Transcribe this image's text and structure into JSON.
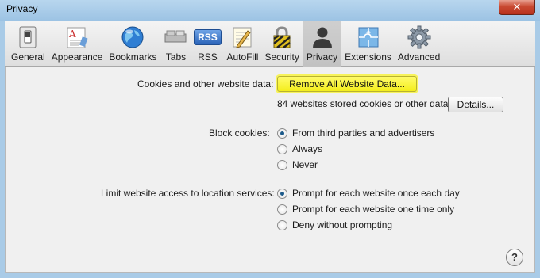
{
  "window": {
    "title": "Privacy",
    "close_label": "✕"
  },
  "toolbar": {
    "items": [
      {
        "label": "General",
        "icon": "switch-icon"
      },
      {
        "label": "Appearance",
        "icon": "font-icon"
      },
      {
        "label": "Bookmarks",
        "icon": "globe-icon"
      },
      {
        "label": "Tabs",
        "icon": "tabs-icon"
      },
      {
        "label": "RSS",
        "icon": "rss-icon"
      },
      {
        "label": "AutoFill",
        "icon": "pencil-icon"
      },
      {
        "label": "Security",
        "icon": "lock-icon"
      },
      {
        "label": "Privacy",
        "icon": "person-silhouette-icon"
      },
      {
        "label": "Extensions",
        "icon": "puzzle-icon"
      },
      {
        "label": "Advanced",
        "icon": "gear-icon"
      }
    ],
    "rss_badge": "RSS",
    "selected": "Privacy"
  },
  "cookies": {
    "label": "Cookies and other website data:",
    "remove_button": "Remove All Website Data...",
    "stored_info": "84 websites stored cookies or other data",
    "details_button": "Details..."
  },
  "block_cookies": {
    "label": "Block cookies:",
    "options": [
      {
        "label": "From third parties and advertisers",
        "checked": true
      },
      {
        "label": "Always",
        "checked": false
      },
      {
        "label": "Never",
        "checked": false
      }
    ]
  },
  "location": {
    "label": "Limit website access to location services:",
    "options": [
      {
        "label": "Prompt for each website once each day",
        "checked": true
      },
      {
        "label": "Prompt for each website one time only",
        "checked": false
      },
      {
        "label": "Deny without prompting",
        "checked": false
      }
    ]
  },
  "help": {
    "label": "?"
  }
}
